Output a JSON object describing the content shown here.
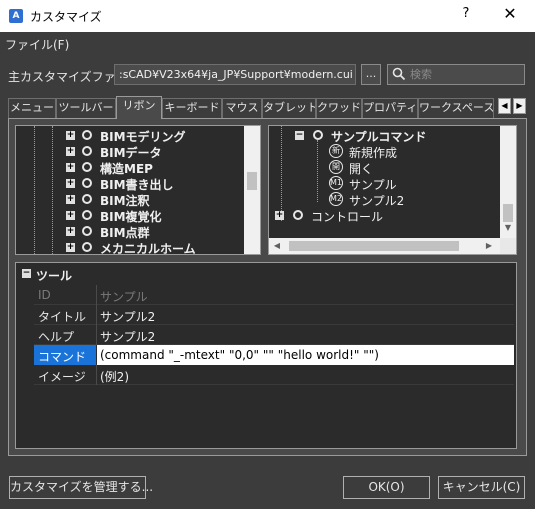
{
  "window": {
    "title": "カスタマイズ",
    "help": "?",
    "close": "✕",
    "app_icon": "A"
  },
  "menu": {
    "file": "ファイル(F)"
  },
  "main_file": {
    "label": "主カスタマイズファイル:",
    "path": ":sCAD¥V23x64¥ja_JP¥Support¥modern.cui",
    "browse": "...",
    "search_placeholder": "検索"
  },
  "tabs": [
    "メニュー",
    "ツールバー",
    "リボン",
    "キーボード",
    "マウス",
    "タブレット",
    "クワッド",
    "プロパティ",
    "ワークスペース"
  ],
  "active_tab": "リボン",
  "tab_scroll": {
    "left": "◀",
    "right": "▶"
  },
  "left_tree": {
    "items": [
      "BIMモデリング",
      "BIMデータ",
      "構造MEP",
      "BIM書き出し",
      "BIM注釈",
      "BIM複覚化",
      "BIM点群",
      "メカニカルホーム"
    ]
  },
  "right_tree": {
    "root": "サンプルコマンド",
    "children": [
      {
        "icon": "新",
        "label": "新規作成"
      },
      {
        "icon": "開",
        "label": "開く"
      },
      {
        "icon": "M1",
        "label": "サンプル"
      },
      {
        "icon": "M2",
        "label": "サンプル2"
      }
    ],
    "sibling": "コントロール"
  },
  "properties": {
    "header": "ツール",
    "rows": [
      {
        "key": "ID",
        "value": "サンプル",
        "state": "disabled"
      },
      {
        "key": "タイトル",
        "value": "サンプル2",
        "state": "normal"
      },
      {
        "key": "ヘルプ",
        "value": "サンプル2",
        "state": "normal"
      },
      {
        "key": "コマンド",
        "value": "(command \"_-mtext\" \"0,0\" \"\" \"hello world!\" \"\")",
        "state": "selected"
      },
      {
        "key": "イメージ",
        "value": "(例2)",
        "state": "normal"
      }
    ]
  },
  "buttons": {
    "manage": "カスタマイズを管理する...",
    "ok": "OK(O)",
    "cancel": "キャンセル(C)"
  },
  "colors": {
    "background": "#3c3c3c",
    "tree_background": "#2b2b2b",
    "selection": "#1a73d9"
  }
}
